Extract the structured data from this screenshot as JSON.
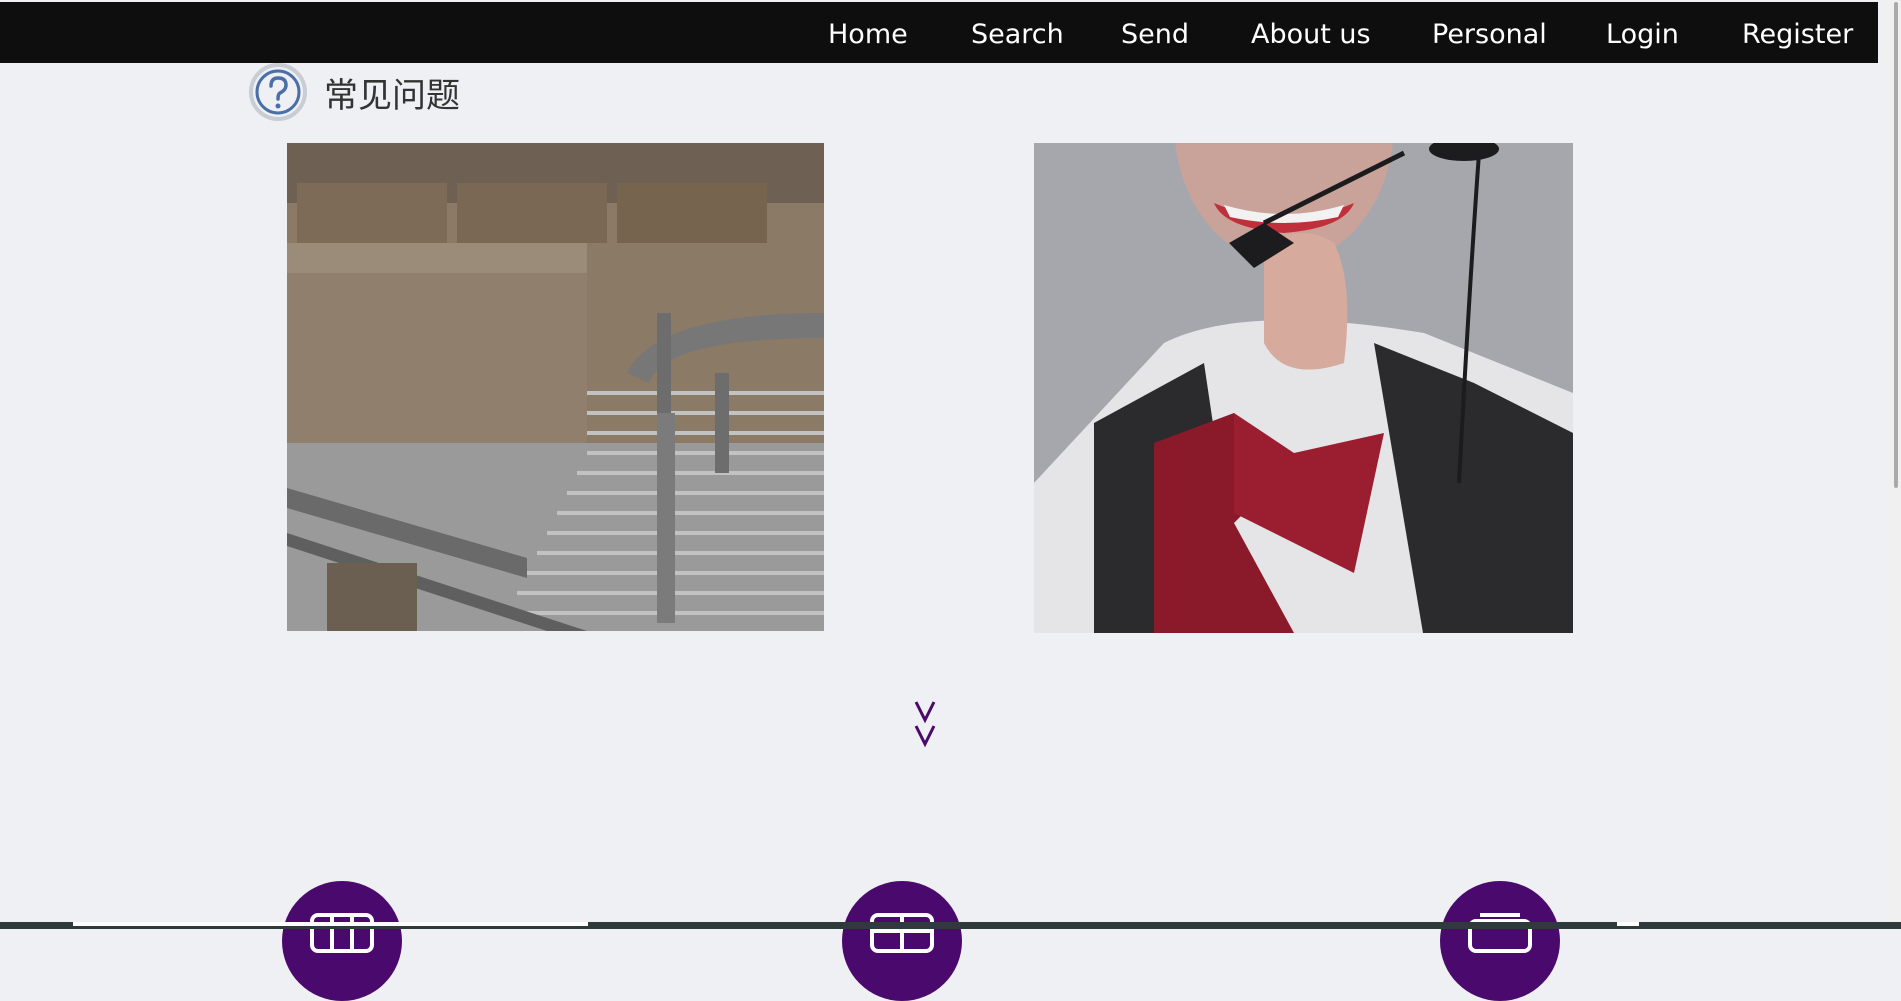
{
  "nav": {
    "items": [
      {
        "label": "Home"
      },
      {
        "label": "Search"
      },
      {
        "label": "Send"
      },
      {
        "label": "About us"
      },
      {
        "label": "Personal"
      },
      {
        "label": "Login"
      },
      {
        "label": "Register"
      }
    ]
  },
  "faq": {
    "title": "常见问题",
    "icon": "question-circle-icon"
  },
  "photos": [
    {
      "subject": "warehouse-conveyor"
    },
    {
      "subject": "customer-service-agent"
    }
  ],
  "scroll_indicator": {
    "icon": "double-chevron-down-icon"
  },
  "feature_icons": {
    "color": "#4a0a6d",
    "count": 3
  },
  "colors": {
    "navbar": "#0e0e0e",
    "background": "#eff0f4",
    "accent": "#4a0a6d"
  }
}
